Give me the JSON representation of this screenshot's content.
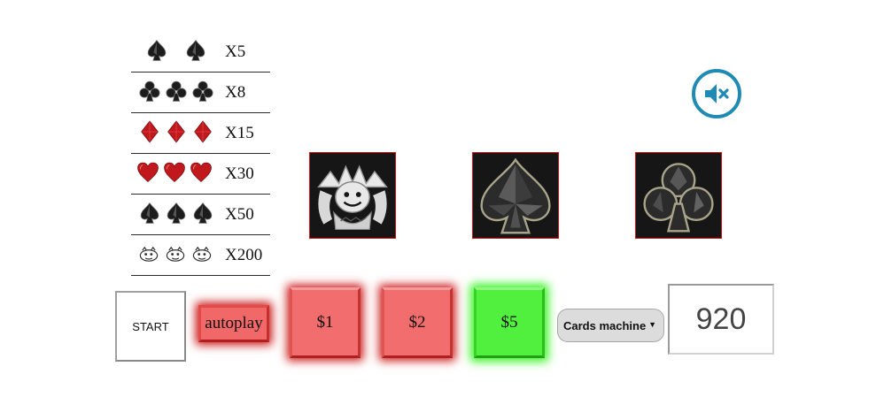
{
  "paytable": [
    {
      "symbols": [
        "spade",
        "spade"
      ],
      "multiplier": "X5"
    },
    {
      "symbols": [
        "club",
        "club",
        "club"
      ],
      "multiplier": "X8"
    },
    {
      "symbols": [
        "diamond",
        "diamond",
        "diamond"
      ],
      "multiplier": "X15"
    },
    {
      "symbols": [
        "heart",
        "heart",
        "heart"
      ],
      "multiplier": "X30"
    },
    {
      "symbols": [
        "spade",
        "spade",
        "spade"
      ],
      "multiplier": "X50"
    },
    {
      "symbols": [
        "joker",
        "joker",
        "joker"
      ],
      "multiplier": "X200"
    }
  ],
  "sound": {
    "icon": "speaker-muted-icon",
    "state": "muted",
    "color": "#1f8ab4"
  },
  "reels": [
    {
      "symbol": "joker"
    },
    {
      "symbol": "spade"
    },
    {
      "symbol": "club"
    }
  ],
  "controls": {
    "start_label": "START",
    "autoplay_label": "autoplay",
    "bets": [
      {
        "label": "$1",
        "selected": false
      },
      {
        "label": "$2",
        "selected": false
      },
      {
        "label": "$5",
        "selected": true
      }
    ],
    "machine": {
      "selected": "Cards machine"
    },
    "credits": "920"
  },
  "colors": {
    "bet_red": "#f26d6d",
    "bet_selected": "#52f03e",
    "reel_border": "#d01414",
    "suit_red": "#c0181c",
    "suit_black": "#1c1c1c"
  }
}
